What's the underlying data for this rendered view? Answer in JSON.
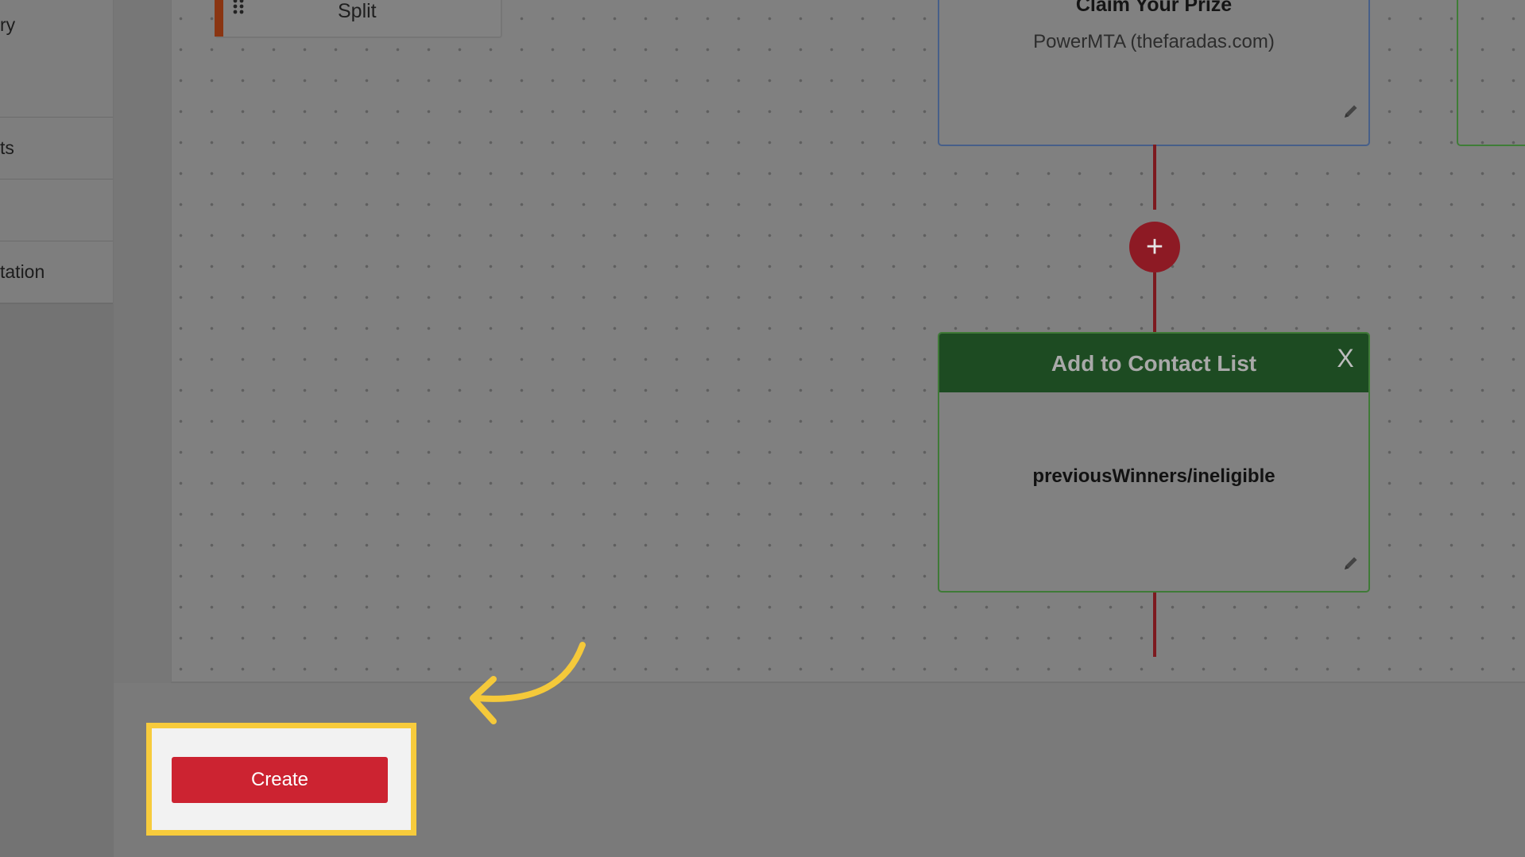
{
  "sidebar": {
    "items": [
      {
        "label": "ry"
      },
      {
        "label": ""
      },
      {
        "label": "ts"
      },
      {
        "label": ""
      },
      {
        "label": "tation"
      }
    ]
  },
  "workflow": {
    "split_node": {
      "label": "Split",
      "icon": "grip-icon"
    },
    "email_node": {
      "title": "Claim Your Prize",
      "sender": "PowerMTA (thefaradas.com)",
      "icon": "pencil-icon"
    },
    "add_step": {
      "label": "+"
    },
    "action_node": {
      "title": "Add to Contact List",
      "close_label": "X",
      "value": "previousWinners/ineligible",
      "icon": "pencil-icon"
    }
  },
  "footer": {
    "create_label": "Create"
  },
  "colors": {
    "highlight": "#f7cb3c",
    "create_button": "#cc2331",
    "action_header": "#1d4b22",
    "connector": "#7d1a1f"
  }
}
